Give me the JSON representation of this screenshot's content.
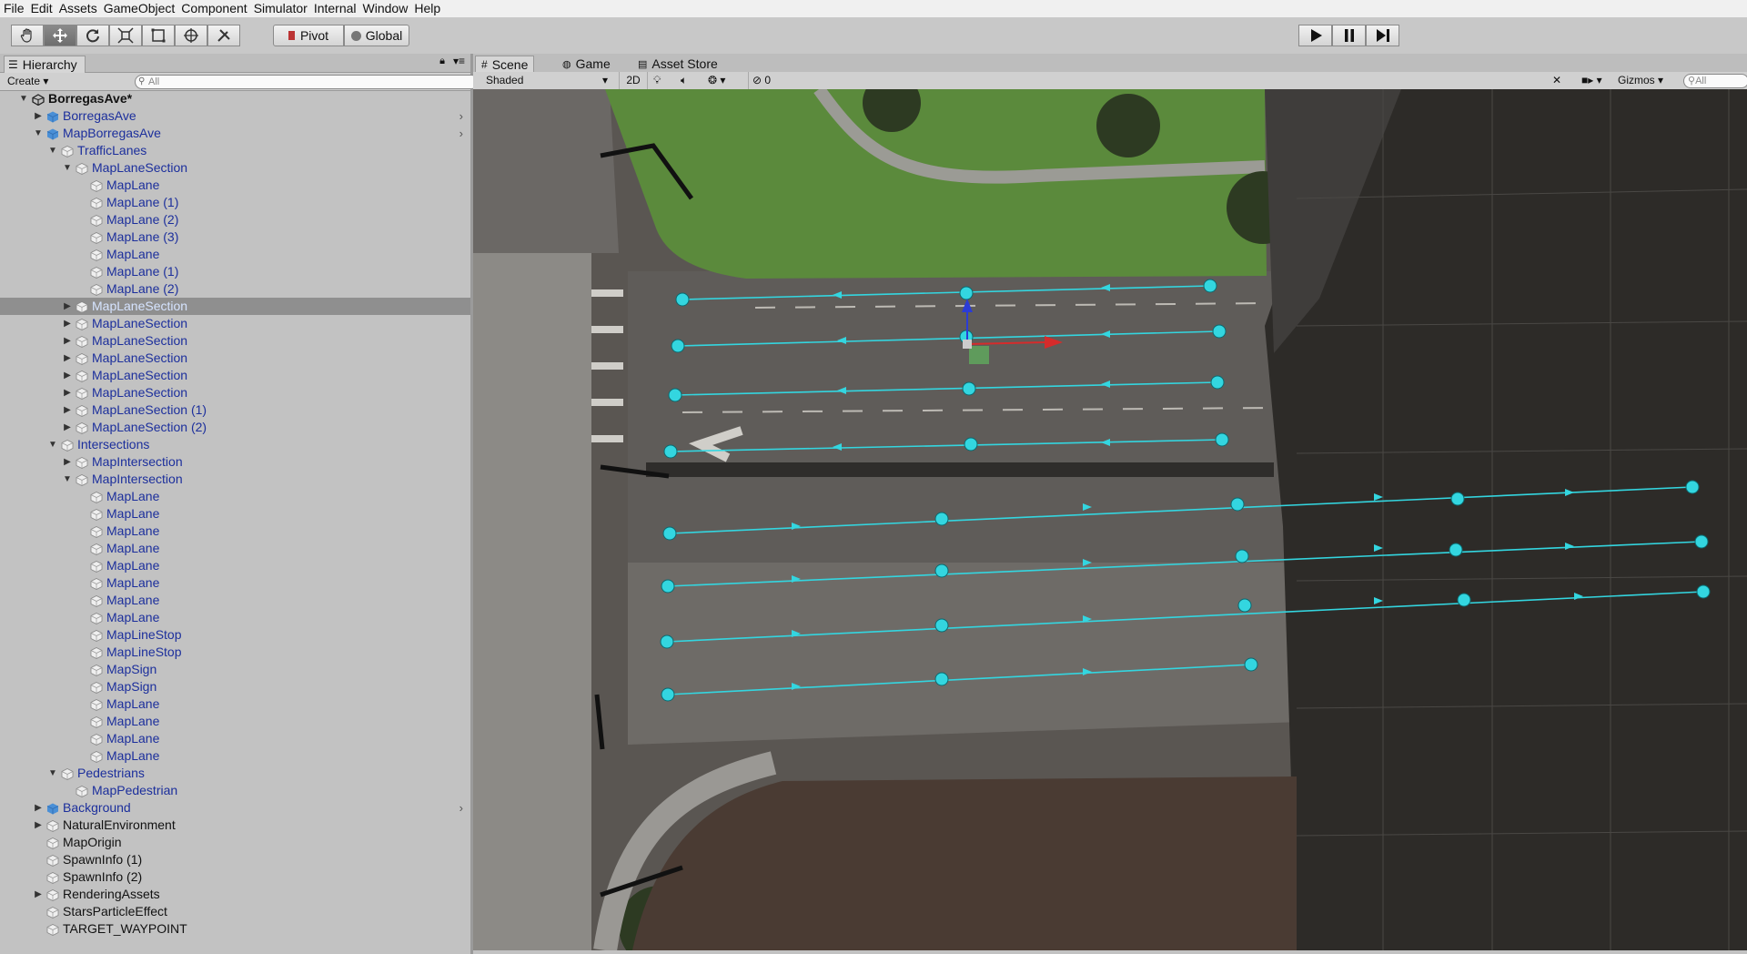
{
  "menu": [
    "File",
    "Edit",
    "Assets",
    "GameObject",
    "Component",
    "Simulator",
    "Internal",
    "Window",
    "Help"
  ],
  "toolbar": {
    "pivot": "Pivot",
    "global": "Global"
  },
  "hierarchy": {
    "tab": "Hierarchy",
    "create": "Create",
    "search_placeholder": "All",
    "rows": [
      {
        "label": "BorregasAve*",
        "depth": 0,
        "arrow": "down",
        "icon": "unity",
        "style": "bold"
      },
      {
        "label": "BorregasAve",
        "depth": 1,
        "arrow": "right",
        "icon": "prefab",
        "style": "blue",
        "chev": true
      },
      {
        "label": "MapBorregasAve",
        "depth": 1,
        "arrow": "down",
        "icon": "prefab",
        "style": "blue",
        "chev": true
      },
      {
        "label": "TrafficLanes",
        "depth": 2,
        "arrow": "down",
        "icon": "cube",
        "style": "blue"
      },
      {
        "label": "MapLaneSection",
        "depth": 3,
        "arrow": "down",
        "icon": "cube",
        "style": "blue"
      },
      {
        "label": "MapLane",
        "depth": 4,
        "arrow": "",
        "icon": "cube",
        "style": "blue"
      },
      {
        "label": "MapLane (1)",
        "depth": 4,
        "arrow": "",
        "icon": "cube",
        "style": "blue"
      },
      {
        "label": "MapLane (2)",
        "depth": 4,
        "arrow": "",
        "icon": "cube",
        "style": "blue"
      },
      {
        "label": "MapLane (3)",
        "depth": 4,
        "arrow": "",
        "icon": "cube",
        "style": "blue"
      },
      {
        "label": "MapLane",
        "depth": 4,
        "arrow": "",
        "icon": "cube",
        "style": "blue"
      },
      {
        "label": "MapLane (1)",
        "depth": 4,
        "arrow": "",
        "icon": "cube",
        "style": "blue"
      },
      {
        "label": "MapLane (2)",
        "depth": 4,
        "arrow": "",
        "icon": "cube",
        "style": "blue"
      },
      {
        "label": "MapLaneSection",
        "depth": 3,
        "arrow": "right",
        "icon": "cube",
        "style": "blue",
        "selected": true
      },
      {
        "label": "MapLaneSection",
        "depth": 3,
        "arrow": "right",
        "icon": "cube",
        "style": "blue"
      },
      {
        "label": "MapLaneSection",
        "depth": 3,
        "arrow": "right",
        "icon": "cube",
        "style": "blue"
      },
      {
        "label": "MapLaneSection",
        "depth": 3,
        "arrow": "right",
        "icon": "cube",
        "style": "blue"
      },
      {
        "label": "MapLaneSection",
        "depth": 3,
        "arrow": "right",
        "icon": "cube",
        "style": "blue"
      },
      {
        "label": "MapLaneSection",
        "depth": 3,
        "arrow": "right",
        "icon": "cube",
        "style": "blue"
      },
      {
        "label": "MapLaneSection (1)",
        "depth": 3,
        "arrow": "right",
        "icon": "cube",
        "style": "blue"
      },
      {
        "label": "MapLaneSection (2)",
        "depth": 3,
        "arrow": "right",
        "icon": "cube",
        "style": "blue"
      },
      {
        "label": "Intersections",
        "depth": 2,
        "arrow": "down",
        "icon": "cube",
        "style": "blue"
      },
      {
        "label": "MapIntersection",
        "depth": 3,
        "arrow": "right",
        "icon": "cube",
        "style": "blue"
      },
      {
        "label": "MapIntersection",
        "depth": 3,
        "arrow": "down",
        "icon": "cube",
        "style": "blue"
      },
      {
        "label": "MapLane",
        "depth": 4,
        "arrow": "",
        "icon": "cube",
        "style": "blue"
      },
      {
        "label": "MapLane",
        "depth": 4,
        "arrow": "",
        "icon": "cube",
        "style": "blue"
      },
      {
        "label": "MapLane",
        "depth": 4,
        "arrow": "",
        "icon": "cube",
        "style": "blue"
      },
      {
        "label": "MapLane",
        "depth": 4,
        "arrow": "",
        "icon": "cube",
        "style": "blue"
      },
      {
        "label": "MapLane",
        "depth": 4,
        "arrow": "",
        "icon": "cube",
        "style": "blue"
      },
      {
        "label": "MapLane",
        "depth": 4,
        "arrow": "",
        "icon": "cube",
        "style": "blue"
      },
      {
        "label": "MapLane",
        "depth": 4,
        "arrow": "",
        "icon": "cube",
        "style": "blue"
      },
      {
        "label": "MapLane",
        "depth": 4,
        "arrow": "",
        "icon": "cube",
        "style": "blue"
      },
      {
        "label": "MapLineStop",
        "depth": 4,
        "arrow": "",
        "icon": "cube",
        "style": "blue"
      },
      {
        "label": "MapLineStop",
        "depth": 4,
        "arrow": "",
        "icon": "cube",
        "style": "blue"
      },
      {
        "label": "MapSign",
        "depth": 4,
        "arrow": "",
        "icon": "cube",
        "style": "blue"
      },
      {
        "label": "MapSign",
        "depth": 4,
        "arrow": "",
        "icon": "cube",
        "style": "blue"
      },
      {
        "label": "MapLane",
        "depth": 4,
        "arrow": "",
        "icon": "cube",
        "style": "blue"
      },
      {
        "label": "MapLane",
        "depth": 4,
        "arrow": "",
        "icon": "cube",
        "style": "blue"
      },
      {
        "label": "MapLane",
        "depth": 4,
        "arrow": "",
        "icon": "cube",
        "style": "blue"
      },
      {
        "label": "MapLane",
        "depth": 4,
        "arrow": "",
        "icon": "cube",
        "style": "blue"
      },
      {
        "label": "Pedestrians",
        "depth": 2,
        "arrow": "down",
        "icon": "cube",
        "style": "blue"
      },
      {
        "label": "MapPedestrian",
        "depth": 3,
        "arrow": "",
        "icon": "cube",
        "style": "blue"
      },
      {
        "label": "Background",
        "depth": 1,
        "arrow": "right",
        "icon": "prefab",
        "style": "blue",
        "chev": true
      },
      {
        "label": "NaturalEnvironment",
        "depth": 1,
        "arrow": "right",
        "icon": "cube",
        "style": "black"
      },
      {
        "label": "MapOrigin",
        "depth": 1,
        "arrow": "",
        "icon": "cube",
        "style": "black"
      },
      {
        "label": "SpawnInfo (1)",
        "depth": 1,
        "arrow": "",
        "icon": "cube",
        "style": "black"
      },
      {
        "label": "SpawnInfo (2)",
        "depth": 1,
        "arrow": "",
        "icon": "cube",
        "style": "black"
      },
      {
        "label": "RenderingAssets",
        "depth": 1,
        "arrow": "right",
        "icon": "cube",
        "style": "black"
      },
      {
        "label": "StarsParticleEffect",
        "depth": 1,
        "arrow": "",
        "icon": "cube",
        "style": "black"
      },
      {
        "label": "TARGET_WAYPOINT",
        "depth": 1,
        "arrow": "",
        "icon": "cube",
        "style": "black"
      }
    ]
  },
  "scene": {
    "tabs": [
      "Scene",
      "Game",
      "Asset Store"
    ],
    "shading": "Shaded",
    "mode_2d": "2D",
    "hidden_count": "0",
    "gizmos": "Gizmos",
    "search_placeholder": "All"
  },
  "colors": {
    "lane": "#33d6e0",
    "selected_row": "#8f8f8f",
    "blue_text": "#1c2f9c"
  }
}
